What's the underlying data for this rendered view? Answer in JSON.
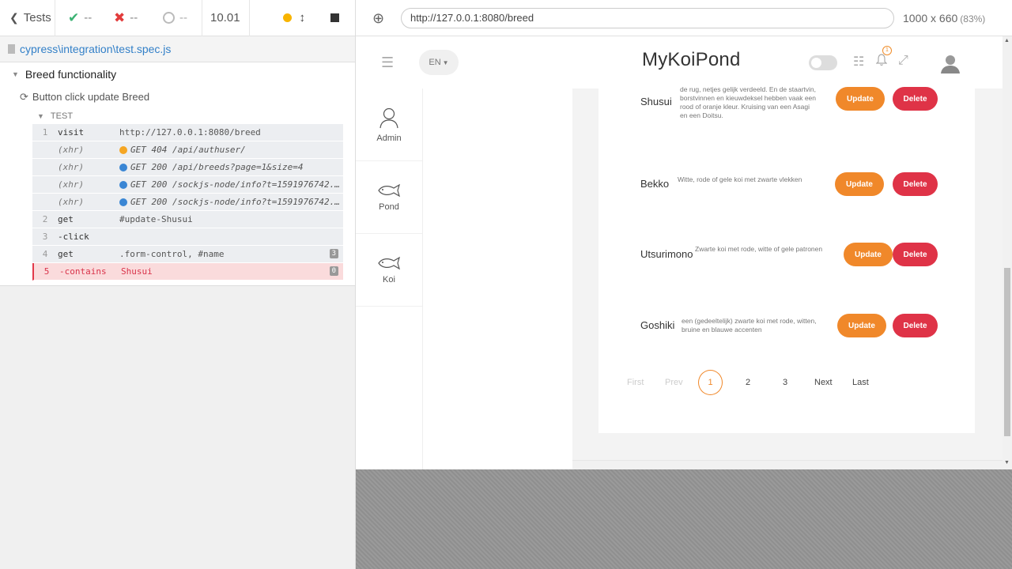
{
  "reporter": {
    "back_label": "Tests",
    "passed": "--",
    "failed": "--",
    "pending": "--",
    "duration": "10.01",
    "spec_path": "cypress\\integration\\test.spec.js",
    "suite_title": "Breed functionality",
    "test_title": "Button click update Breed",
    "hook_label": "TEST",
    "commands": [
      {
        "num": "1",
        "name": "visit",
        "msg": "http://127.0.0.1:8080/breed"
      },
      {
        "num": "",
        "name": "(xhr)",
        "msg": "GET 404 /api/authuser/",
        "bullet": "#f5a623"
      },
      {
        "num": "",
        "name": "(xhr)",
        "msg": "GET 200 /api/breeds?page=1&size=4",
        "bullet": "#3a86d4"
      },
      {
        "num": "",
        "name": "(xhr)",
        "msg": "GET 200 /sockjs-node/info?t=1591976742...",
        "bullet": "#3a86d4"
      },
      {
        "num": "",
        "name": "(xhr)",
        "msg": "GET 200 /sockjs-node/info?t=1591976742...",
        "bullet": "#3a86d4"
      },
      {
        "num": "2",
        "name": "get",
        "msg": "#update-Shusui"
      },
      {
        "num": "3",
        "name": "-click",
        "msg": ""
      },
      {
        "num": "4",
        "name": "get",
        "msg": ".form-control, #name",
        "count": "3"
      },
      {
        "num": "5",
        "name": "-contains",
        "msg": "Shusui",
        "count": "0"
      }
    ]
  },
  "aut": {
    "url": "http://127.0.0.1:8080/breed",
    "viewport": "1000 x 660",
    "scale": "(83%)"
  },
  "app": {
    "brand": "MyKoiPond",
    "lang": "EN",
    "notification_count": "1",
    "nav": [
      {
        "label": "Admin",
        "icon": "user-icon"
      },
      {
        "label": "Pond",
        "icon": "fish-icon"
      },
      {
        "label": "Koi",
        "icon": "fish-icon"
      }
    ],
    "breeds": [
      {
        "name": "Shusui",
        "desc": "de rug, netjes gelijk verdeeld. En de staartvin, borstvinnen en kieuwdeksel hebben vaak een rood of oranje kleur. Kruising van een Asagi en een Doitsu."
      },
      {
        "name": "Bekko",
        "desc": "Witte, rode of gele koi met zwarte vlekken"
      },
      {
        "name": "Utsurimono",
        "desc": "Zwarte koi met rode, witte of gele patronen"
      },
      {
        "name": "Goshiki",
        "desc": "een (gedeeltelijk) zwarte koi met rode, witten, bruine en blauwe accenten"
      }
    ],
    "update_label": "Update",
    "delete_label": "Delete",
    "pager": {
      "first": "First",
      "prev": "Prev",
      "pages": [
        "1",
        "2",
        "3"
      ],
      "next": "Next",
      "last": "Last"
    }
  },
  "colors": {
    "update": "#f0882a",
    "delete": "#df3347",
    "failed_row": "#fadbdc"
  }
}
